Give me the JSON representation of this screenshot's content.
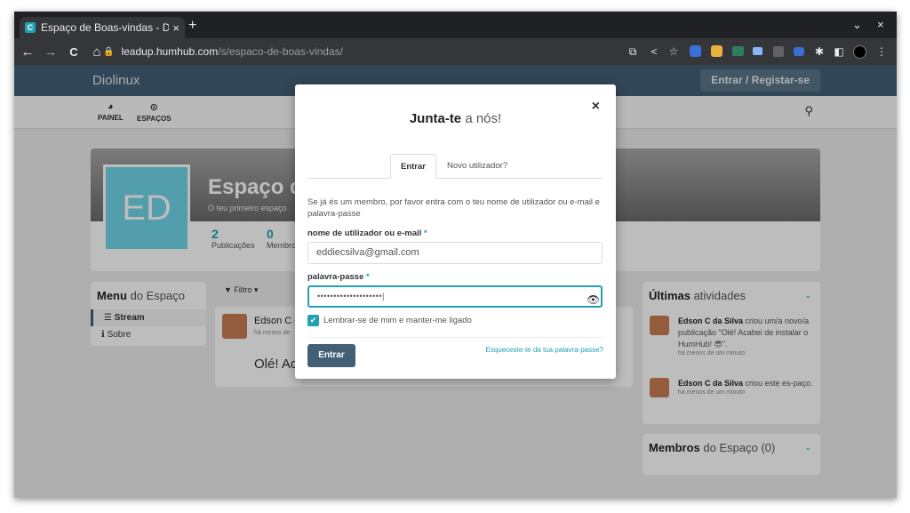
{
  "browser": {
    "tab_title": "Espaço de Boas-vindas - D",
    "tab_close": "×",
    "new_tab": "+",
    "url_host": "leadup.humhub.com",
    "url_path": "/s/espaco-de-boas-vindas/",
    "back": "←",
    "forward": "→",
    "reload": "C",
    "home": "⌂",
    "win_min": "⌄",
    "win_close": "×"
  },
  "site": {
    "brand": "Diolinux",
    "login_button": "Entrar / Registar-se",
    "nav": [
      {
        "label": "PAINEL",
        "icon": "dashboard-icon"
      },
      {
        "label": "ESPAÇOS",
        "icon": "spaces-icon"
      }
    ]
  },
  "space": {
    "initials": "ED",
    "name": "Espaço de",
    "description": "O teu primeiro espaço",
    "stats": [
      {
        "value": "2",
        "label": "Publicações"
      },
      {
        "value": "0",
        "label": "Membro"
      }
    ]
  },
  "menu": {
    "title_bold": "Menu",
    "title_rest": " do Espaço",
    "items": [
      "Stream",
      "Sobre"
    ]
  },
  "stream": {
    "filter_label": "Filtro",
    "post_author": "Edson C d",
    "post_time": "há menos de",
    "post_body": "Olé! Ac"
  },
  "activities": {
    "title_bold": "Últimas",
    "title_rest": " atividades",
    "items": [
      {
        "author": "Edson C da Silva",
        "text": " criou um/a novo/a publicação \"Olé! Acabei de instalar o HumHub! 😎\".",
        "time": "há menos de um minuto"
      },
      {
        "author": "Edson C da Silva",
        "text": " criou este es-paço.",
        "time": "há menos de um minuto"
      }
    ]
  },
  "members": {
    "title_bold": "Membros",
    "title_rest": " do Espaço (0)"
  },
  "modal": {
    "title_bold": "Junta-te",
    "title_rest": " a nós!",
    "close": "×",
    "tab_login": "Entrar",
    "tab_register": "Novo utilizador?",
    "intro": "Se já és um membro, por favor entra com o teu nome de utilizador ou e-mail e palavra-passe",
    "username_label": "nome de utilizador ou e-mail",
    "username_value": "eddiecsilva@gmail.com",
    "password_label": "palavra-passe",
    "password_value": "••••••••••••••••••••|",
    "required_mark": "*",
    "remember_label": "Lembrar-se de mim e manter-me ligado",
    "submit": "Entrar",
    "forgot": "Esqueceste-te da tua palavra-passe?"
  },
  "colors": {
    "accent": "#21a1b3",
    "topbar": "#435f76"
  }
}
